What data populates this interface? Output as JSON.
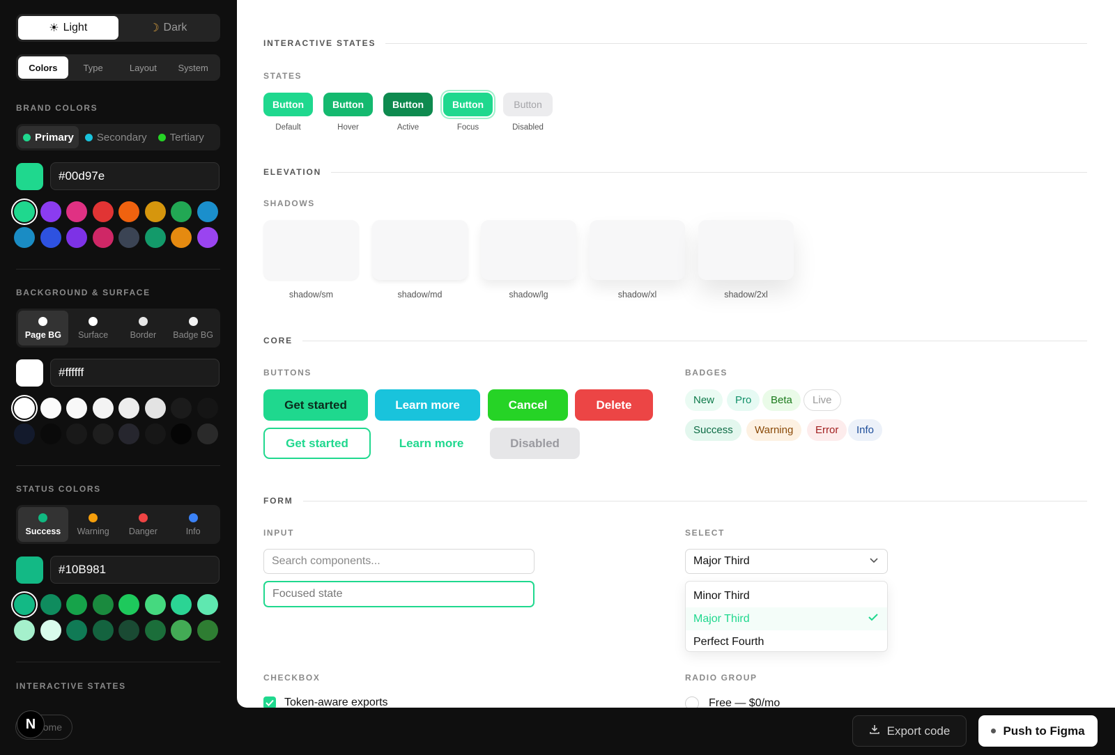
{
  "theme": {
    "light": "Light",
    "dark": "Dark"
  },
  "tabs": [
    "Colors",
    "Type",
    "Layout",
    "System"
  ],
  "brand": {
    "label": "BRAND COLORS",
    "options": [
      {
        "name": "Primary",
        "color": "#1fd88e"
      },
      {
        "name": "Secondary",
        "color": "#19c3dc"
      },
      {
        "name": "Tertiary",
        "color": "#26d326"
      }
    ],
    "hex": "#00d97e",
    "swatch": "#1fd88e",
    "swatches": [
      "#1fd88e",
      "#8b3cf0",
      "#e03183",
      "#e13434",
      "#f0620f",
      "#d6960d",
      "#22a854",
      "#1b8fcc",
      "#1a8cc4",
      "#2e52e0",
      "#7d32e6",
      "#cf2766",
      "#3b4454",
      "#139a6a",
      "#e58a10",
      "#9a44f0"
    ]
  },
  "background": {
    "label": "BACKGROUND & SURFACE",
    "options": [
      "Page BG",
      "Surface",
      "Border",
      "Badge BG"
    ],
    "hex": "#ffffff",
    "swatch": "#ffffff",
    "swatches": [
      "#ffffff",
      "#fbfbfb",
      "#f8f8f8",
      "#f3f3f3",
      "#ededed",
      "#e3e3e3",
      "#1b1b1b",
      "#151515",
      "#131a2c",
      "#0a0a0a",
      "#191919",
      "#1e1e1e",
      "#26262e",
      "#171717",
      "#050505",
      "#2a2a2a"
    ]
  },
  "status": {
    "label": "STATUS COLORS",
    "options": [
      {
        "name": "Success",
        "color": "#10b981"
      },
      {
        "name": "Warning",
        "color": "#f59e0b"
      },
      {
        "name": "Danger",
        "color": "#ef4444"
      },
      {
        "name": "Info",
        "color": "#3b82f6"
      }
    ],
    "hex": "#10B981",
    "swatch": "#13b985",
    "swatches": [
      "#13b985",
      "#0f8c5e",
      "#16a34a",
      "#1a8a3e",
      "#1ec95c",
      "#45d97f",
      "#2bd494",
      "#5fe8b0",
      "#a5f0cc",
      "#d9fcec",
      "#107a55",
      "#14633f",
      "#1a4a33",
      "#1b6e3a",
      "#43ab55",
      "#2e7d32"
    ]
  },
  "sidebar_interactive_label": "INTERACTIVE STATES",
  "main": {
    "interactive": {
      "heading": "INTERACTIVE STATES",
      "states_label": "STATES",
      "states": [
        {
          "label": "Button",
          "caption": "Default",
          "color": "#1fd88e"
        },
        {
          "label": "Button",
          "caption": "Hover",
          "color": "#14b96f"
        },
        {
          "label": "Button",
          "caption": "Active",
          "color": "#0e8a4f"
        },
        {
          "label": "Button",
          "caption": "Focus",
          "color": "#1fd88e"
        },
        {
          "label": "Button",
          "caption": "Disabled",
          "color": "#ececee"
        }
      ]
    },
    "elevation": {
      "heading": "ELEVATION",
      "shadows_label": "SHADOWS",
      "shadows": [
        "shadow/sm",
        "shadow/md",
        "shadow/lg",
        "shadow/xl",
        "shadow/2xl"
      ]
    },
    "core": {
      "heading": "CORE",
      "buttons_label": "BUTTONS",
      "buttons": {
        "get_started": "Get started",
        "learn_more": "Learn more",
        "cancel": "Cancel",
        "delete": "Delete",
        "outline_get_started": "Get started",
        "ghost_learn_more": "Learn more",
        "disabled": "Disabled"
      },
      "badges_label": "BADGES",
      "badges": [
        "New",
        "Pro",
        "Beta",
        "Live",
        "Success",
        "Warning",
        "Error",
        "Info"
      ]
    },
    "form": {
      "heading": "FORM",
      "input_label": "INPUT",
      "input_placeholder": "Search components...",
      "input_focused": "Focused state",
      "select_label": "SELECT",
      "select_value": "Major Third",
      "options": [
        "Minor Third",
        "Major Third",
        "Perfect Fourth"
      ],
      "checkbox_label": "CHECKBOX",
      "checkbox_item": "Token-aware exports",
      "radio_label": "RADIO GROUP",
      "radio_item": "Free — $0/mo"
    }
  },
  "bottom": {
    "home": "ome",
    "logo": "N",
    "export": "Export code",
    "figma": "Push to Figma"
  }
}
